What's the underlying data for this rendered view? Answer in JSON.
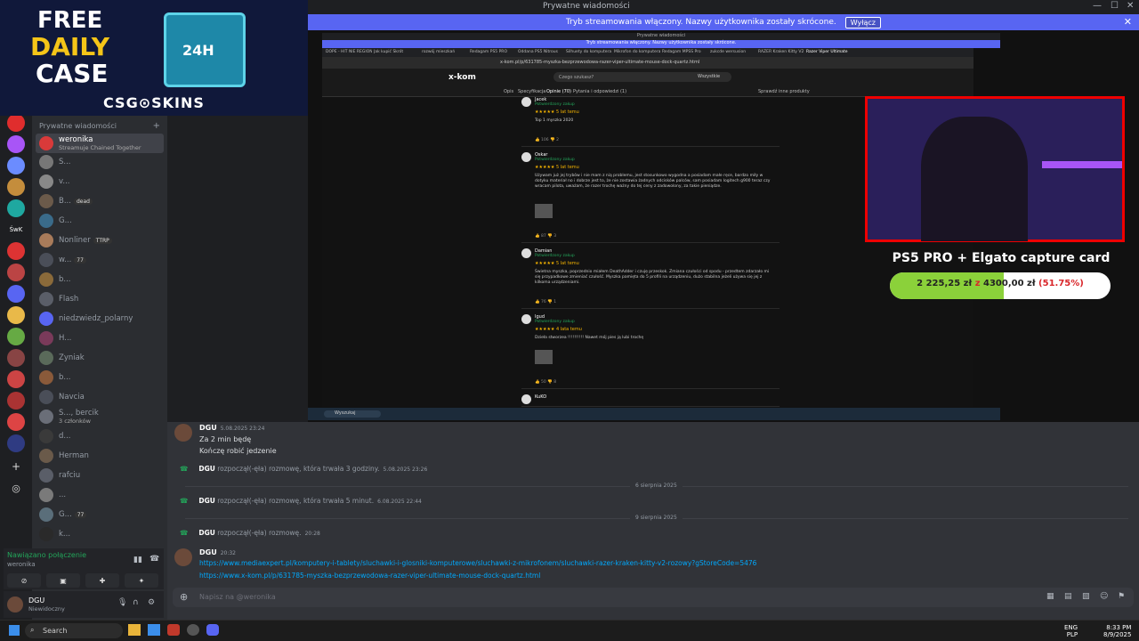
{
  "window": {
    "title": "Prywatne wiadomości"
  },
  "banner": {
    "text": "Tryb streamowania włączony. Nazwy użytkownika zostały skrócone.",
    "button": "Wyłącz"
  },
  "logo": {
    "free": "FREE",
    "daily": "DAILY",
    "case": "CASE",
    "box": "24H",
    "brand": "CSG⊙SKINS"
  },
  "sidebar": {
    "header": "Prywatne wiadomości",
    "items": [
      {
        "name": "weronika",
        "sub": "Streamuje Chained Together"
      },
      {
        "name": "S..."
      },
      {
        "name": "v..."
      },
      {
        "name": "B...",
        "badge": "dead"
      },
      {
        "name": "G..."
      },
      {
        "name": "Nonliner",
        "badge": "TTRP"
      },
      {
        "name": "w...",
        "badge": "77"
      },
      {
        "name": "b..."
      },
      {
        "name": "Flash"
      },
      {
        "name": "niedzwiedz_polarny"
      },
      {
        "name": "H..."
      },
      {
        "name": "Zyniak"
      },
      {
        "name": "b..."
      },
      {
        "name": "Navcia"
      },
      {
        "name": "S..., bercik",
        "sub": "3 członków"
      },
      {
        "name": "d..."
      },
      {
        "name": "Herman"
      },
      {
        "name": "rafciu"
      },
      {
        "name": "..."
      },
      {
        "name": "G...",
        "badge": "77"
      },
      {
        "name": "k..."
      }
    ],
    "rail_label": "ŚwK"
  },
  "voice": {
    "status": "Nawiązano połączenie",
    "channel": "weronika"
  },
  "user": {
    "name": "DGU",
    "status": "Niewidoczny"
  },
  "stream": {
    "inner_title": "Prywatne wiadomości",
    "inner_banner": "Tryb streamowania włączony. Nazwy użytkownika zostały skrócone.",
    "tabs": [
      "DOPE - HIT NIE REGION",
      "Jak kupić Skrót",
      "rozwój mieszkań",
      "Redagam PS5 PRO",
      "Oddana PS5 Nitrous",
      "Silhuety do komputera",
      "Mikrofon do komputera",
      "Redagam MPSS Pro",
      "zukcde wersusion",
      "RAZER Kraken Kitty V2",
      "Razer Viper Ultimate"
    ],
    "url": "x-kom.pl/p/631785-myszka-bezprzewodowa-razer-viper-ultimate-mouse-dock-quartz.html",
    "site_logo": "x-kom",
    "search_placeholder": "Czego szukasz?",
    "search_cat": "Wszystkie",
    "nav": [
      "Opis",
      "Specyfikacja",
      "Opinie (70)",
      "Pytania i odpowiedzi (1)"
    ],
    "nav_right": "Sprawdź inne produkty",
    "reviews": [
      {
        "name": "Jacek",
        "verified": "Potwierdzony zakup",
        "stars": "★★★★★ 5 lat temu",
        "text": "Top 1 myszka 2020",
        "thumbs": "👍 106   👎 2"
      },
      {
        "name": "Oskar",
        "verified": "Potwierdzony zakup",
        "stars": "★★★★★ 5 lat temu",
        "text": "Używam już jej trybów i nie mam z nią problemu, jest stosunkowo wygodna a posiadam małe ręce, bardzo miły w dotyku materiał no i dobrze jest to, że nie zostawia żadnych odcisków palców, sam posiadam logitech g900 teraz czy wracam pilota, uważam, że razer trochę ważny do tej ceny z zadowolony, za takie pieniądze.",
        "thumbs": "👍 87   👎 3"
      },
      {
        "name": "Damian",
        "verified": "Potwierdzony zakup",
        "stars": "★★★★★ 5 lat temu",
        "text": "Świetna myszka, poprzednio miałem DeathAdder i czuję przeskok. Zmiana czułości od spodu - przedtem zdarzało mi się przypadkowe zmieniać czułość. Myszka pamięta do 5 profili na urządzeniu, dużo stabilna jeżeli używa się jej z kilkoma urządzeniami.",
        "thumbs": "👍 76   👎 1"
      },
      {
        "name": "Igud",
        "verified": "Potwierdzony zakup",
        "stars": "★★★★★ 4 lata temu",
        "text": "Dzieła stworzea !!!!!!!!!! Nawet mój pies ją lubi trochę",
        "thumbs": "👍 50   👎 8"
      },
      {
        "name": "KuKO",
        "verified": "",
        "stars": "",
        "text": "",
        "thumbs": ""
      }
    ],
    "inner_taskbar_search": "Wyszukaj"
  },
  "overlay": {
    "title": "PS5 PRO + Elgato capture card",
    "current": "2 225,25 zł",
    "goal": "4300,00 zł",
    "percent": "(51.75%)",
    "progress_fraction": 0.5175,
    "accent": "#8bd13a"
  },
  "chat": {
    "messages": [
      {
        "author": "DGU",
        "time": "5.08.2025 23:24",
        "lines": [
          "Za 2 min będę",
          "Kończę robić jedzenie"
        ]
      }
    ],
    "calls": [
      {
        "author": "DGU",
        "text": "rozpoczął(-ęła) rozmowę, która trwała 3 godziny.",
        "time": "5.08.2025 23:26"
      },
      {
        "author": "DGU",
        "text": "rozpoczął(-ęła) rozmowę, która trwała 5 minut.",
        "time": "6.08.2025 22:44"
      },
      {
        "author": "DGU",
        "text": "rozpoczął(-ęła) rozmowę.",
        "time": "20:28"
      }
    ],
    "dividers": [
      "6 sierpnia 2025",
      "9 sierpnia 2025"
    ],
    "last": {
      "author": "DGU",
      "time": "20:32",
      "links": [
        "https://www.mediaexpert.pl/komputery-i-tablety/sluchawki-i-glosniki-komputerowe/sluchawki-z-mikrofonem/sluchawki-razer-kraken-kitty-v2-rozowy?gStoreCode=5476",
        "https://www.x-kom.pl/p/631785-myszka-bezprzewodowa-razer-viper-ultimate-mouse-dock-quartz.html"
      ]
    },
    "input_placeholder": "Napisz na @weronika"
  },
  "taskbar": {
    "search": "Search",
    "lang": "ENG",
    "lang2": "PLP",
    "time": "8:33 PM",
    "date": "8/9/2025"
  }
}
